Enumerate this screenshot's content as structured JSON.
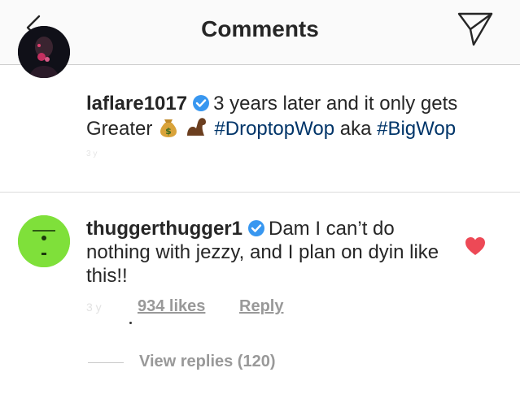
{
  "header": {
    "title": "Comments",
    "back_icon": "chevron-left-icon",
    "share_icon": "paper-plane-icon"
  },
  "caption": {
    "username": "laflare1017",
    "text_before": "3 years later and it only gets Greater",
    "emojis": [
      "money-bag-emoji",
      "flexed-biceps-emoji"
    ],
    "hashtag1": "#DroptopWop",
    "mid_text": "aka",
    "hashtag2": "#BigWop",
    "time_faded": "3 y"
  },
  "comment": {
    "username": "thuggerthugger1",
    "text": "Dam I can’t do nothing with jezzy, and I plan on dyin like this!!",
    "time_faded": "3 y",
    "likes": "934 likes",
    "reply_label": "Reply",
    "liked": true,
    "view_replies": "View replies (120)"
  },
  "colors": {
    "text": "#262626",
    "hashtag": "#003569",
    "meta": "#999999",
    "verified": "#3897f0",
    "heart": "#ed4956",
    "header_bg": "#fafafa"
  }
}
